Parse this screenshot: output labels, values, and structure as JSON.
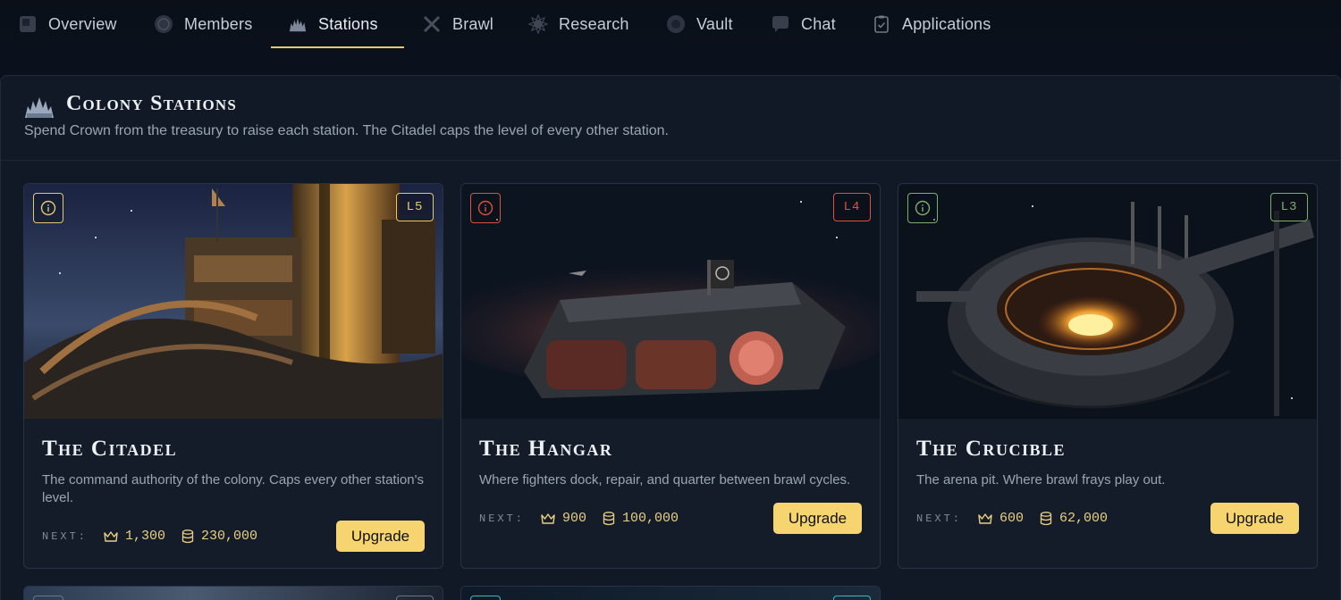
{
  "nav": {
    "tabs": [
      {
        "label": "Overview",
        "icon": "overview-icon"
      },
      {
        "label": "Members",
        "icon": "members-icon"
      },
      {
        "label": "Stations",
        "icon": "stations-icon",
        "active": true
      },
      {
        "label": "Brawl",
        "icon": "brawl-icon"
      },
      {
        "label": "Research",
        "icon": "research-icon"
      },
      {
        "label": "Vault",
        "icon": "vault-icon"
      },
      {
        "label": "Chat",
        "icon": "chat-icon"
      },
      {
        "label": "Applications",
        "icon": "applications-icon"
      }
    ]
  },
  "panel": {
    "title": "Colony Stations",
    "subtitle": "Spend Crown from the treasury to raise each station. The Citadel caps the level of every other station."
  },
  "stations": [
    {
      "name": "The Citadel",
      "level": "L5",
      "accent": "#e6c873",
      "description": "The command authority of the colony. Caps every other station's level.",
      "next_label": "NEXT:",
      "crown_cost": "1,300",
      "treasury_cost": "230,000",
      "upgrade_label": "Upgrade"
    },
    {
      "name": "The Hangar",
      "level": "L4",
      "accent": "#e0503c",
      "description": "Where fighters dock, repair, and quarter between brawl cycles.",
      "next_label": "NEXT:",
      "crown_cost": "900",
      "treasury_cost": "100,000",
      "upgrade_label": "Upgrade"
    },
    {
      "name": "The Crucible",
      "level": "L3",
      "accent": "#7fae6a",
      "description": "The arena pit. Where brawl frays play out.",
      "next_label": "NEXT:",
      "crown_cost": "600",
      "treasury_cost": "62,000",
      "upgrade_label": "Upgrade"
    }
  ],
  "colors": {
    "background": "#0b111c",
    "panel": "#111927",
    "gold": "#f6d46f",
    "text_muted": "#9aa5b4"
  }
}
